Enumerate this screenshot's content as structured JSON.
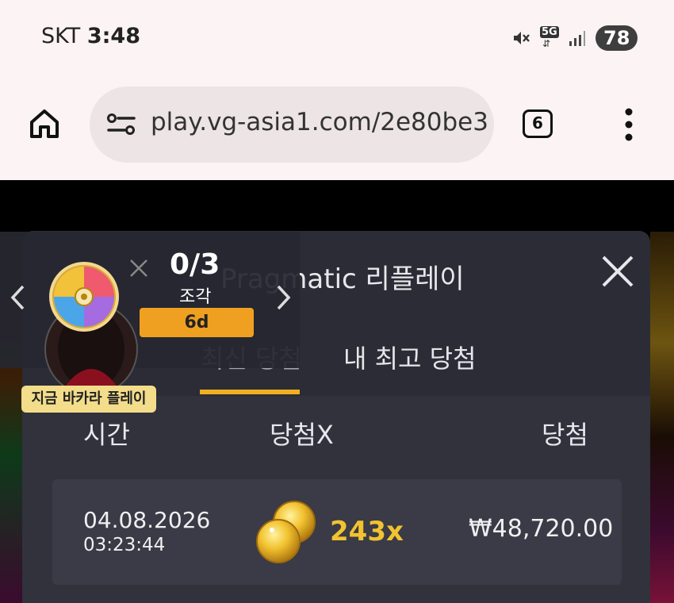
{
  "status_bar": {
    "carrier": "SKT",
    "time": "3:48",
    "network": "5G",
    "battery": "78"
  },
  "browser": {
    "url": "play.vg-asia1.com/2e80be3",
    "tab_count": "6"
  },
  "panel": {
    "title": "Pragmatic 리플레이",
    "tabs": [
      {
        "label": "최신 당첨"
      },
      {
        "label": "내 최고 당첨"
      }
    ],
    "columns": [
      "시간",
      "당첨X",
      "당첨"
    ],
    "rows": [
      {
        "date": "04.08.2026",
        "time": "03:23:44",
        "multiplier": "243x",
        "win": "₩48,720.00"
      }
    ]
  },
  "promo": {
    "progress": "0/3",
    "unit": "조각",
    "days": "6d",
    "cta": "지금 바카라 플레이"
  },
  "colors": {
    "accent": "#f0b020",
    "multiplier": "#f2c230",
    "panel": "#31323c"
  }
}
